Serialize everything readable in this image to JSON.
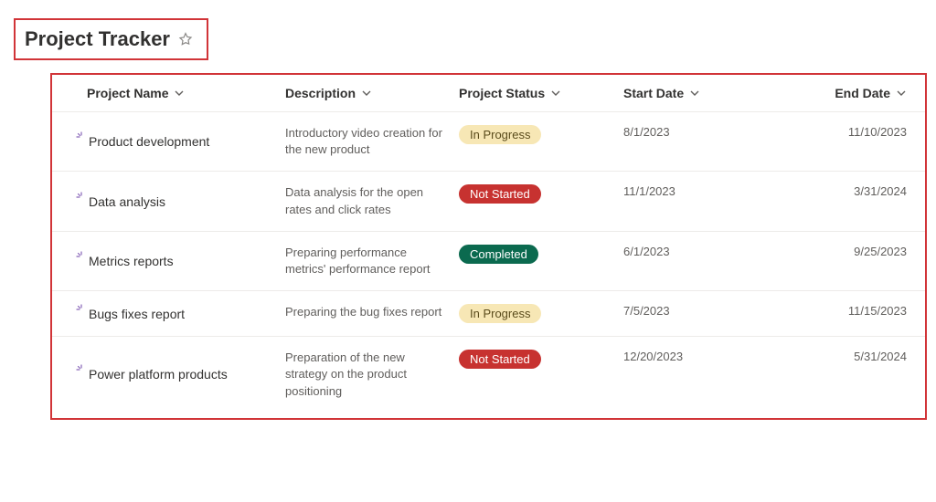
{
  "header": {
    "title": "Project Tracker"
  },
  "columns": {
    "name": "Project Name",
    "description": "Description",
    "status": "Project Status",
    "start": "Start Date",
    "end": "End Date"
  },
  "status_styles": {
    "In Progress": "in-progress",
    "Not Started": "not-started",
    "Completed": "completed"
  },
  "rows": [
    {
      "name": "Product development",
      "description": "Introductory video creation for the new product",
      "status": "In Progress",
      "start": "8/1/2023",
      "end": "11/10/2023"
    },
    {
      "name": "Data analysis",
      "description": "Data analysis for the open rates and click rates",
      "status": "Not Started",
      "start": "11/1/2023",
      "end": "3/31/2024"
    },
    {
      "name": "Metrics reports",
      "description": "Preparing performance metrics' performance report",
      "status": "Completed",
      "start": "6/1/2023",
      "end": "9/25/2023"
    },
    {
      "name": "Bugs fixes report",
      "description": "Preparing the bug fixes report",
      "status": "In Progress",
      "start": "7/5/2023",
      "end": "11/15/2023"
    },
    {
      "name": "Power platform products",
      "description": "Preparation of the new strategy on the product positioning",
      "status": "Not Started",
      "start": "12/20/2023",
      "end": "5/31/2024"
    }
  ]
}
